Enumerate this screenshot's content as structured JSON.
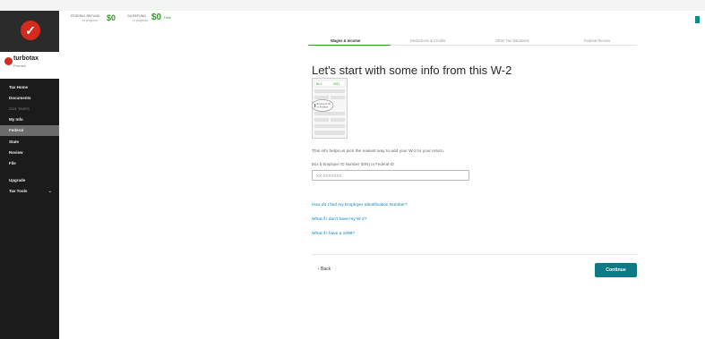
{
  "app": {
    "brand": "turbotax",
    "edition": "Premier"
  },
  "sidebar": {
    "items": [
      {
        "label": "Tax Home"
      },
      {
        "label": "Documents"
      },
      {
        "label": "2021 TAXES"
      },
      {
        "label": "My Info"
      },
      {
        "label": "Federal"
      },
      {
        "label": "State"
      },
      {
        "label": "Review"
      },
      {
        "label": "File"
      },
      {
        "label": "Upgrade"
      },
      {
        "label": "Tax Tools"
      }
    ],
    "chevron": "⌄"
  },
  "refund": {
    "federal_label": "FEDERAL REFUND",
    "federal_sub": "In progress",
    "federal_amount": "$0",
    "state_label": "GA REFUND",
    "state_sub": "In progress",
    "state_amount": "$0",
    "hide_label": "Hide"
  },
  "steps": [
    {
      "label": "Wages & Income"
    },
    {
      "label": "Deductions & Credits"
    },
    {
      "label": "Other Tax Situations"
    },
    {
      "label": "Federal Review"
    }
  ],
  "page": {
    "title": "Let's start with some info from this W-2",
    "w2_badge": "W-2",
    "w2_year": "2021",
    "w2_highlight_line1": "Employer ID",
    "w2_highlight_line2": "or Federal",
    "info_text": "This info helps us pick the easiest way to add your W-2 to your return.",
    "field_label": "Box b Employer ID Number (EIN) or Federal ID",
    "field_placeholder": "XX-XXXXXXX"
  },
  "links": [
    {
      "label": "How do I find my Employer Identification Number?"
    },
    {
      "label": "What if I don't have my W-2?"
    },
    {
      "label": "What if I have a 1099?"
    }
  ],
  "actions": {
    "back_label": "‹ Back",
    "continue_label": "Continue"
  },
  "colors": {
    "accent": "#0d7a86",
    "brand_red": "#d52b1e",
    "refund_green": "#2ca01c",
    "link": "#0a7ec2",
    "sidebar_bg": "#1b1b1b"
  }
}
